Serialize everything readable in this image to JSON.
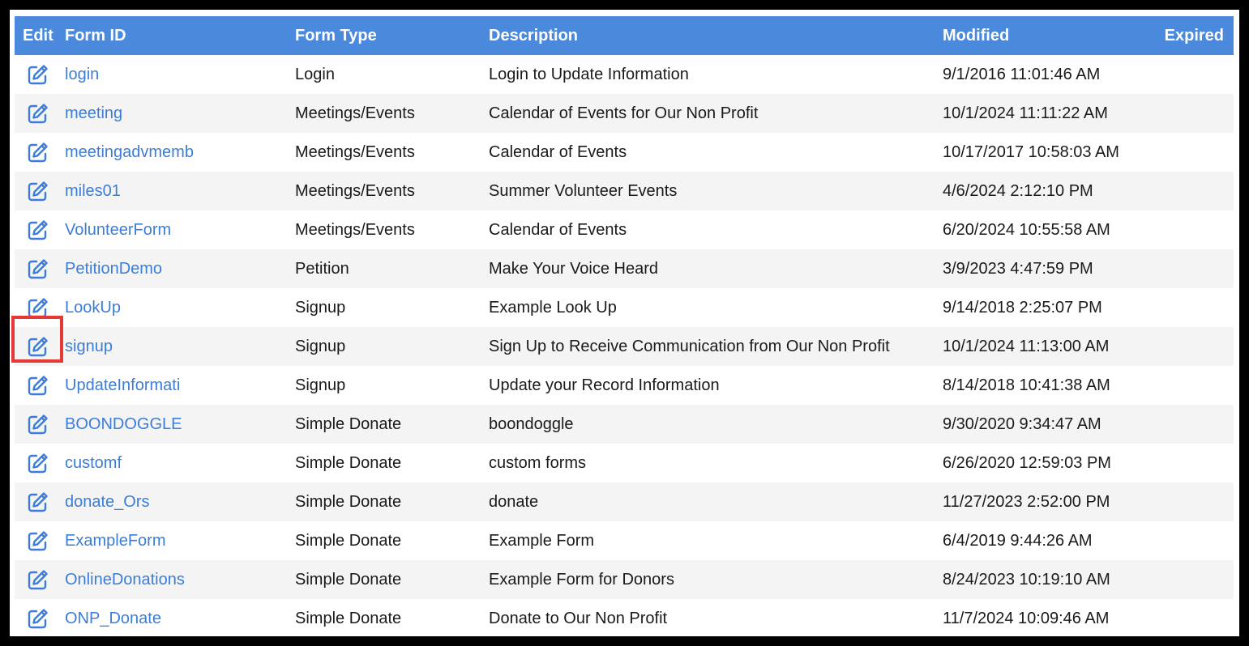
{
  "colors": {
    "header_bg": "#4a89dc",
    "link": "#3b7dd8",
    "highlight": "#e53935"
  },
  "table": {
    "headers": {
      "edit": "Edit",
      "form_id": "Form ID",
      "form_type": "Form Type",
      "description": "Description",
      "modified": "Modified",
      "expired": "Expired"
    },
    "rows": [
      {
        "form_id": "login",
        "form_type": "Login",
        "description": "Login to Update Information",
        "modified": "9/1/2016 11:01:46 AM",
        "expired": ""
      },
      {
        "form_id": "meeting",
        "form_type": "Meetings/Events",
        "description": "Calendar of Events for Our Non Profit",
        "modified": "10/1/2024 11:11:22 AM",
        "expired": ""
      },
      {
        "form_id": "meetingadvmemb",
        "form_type": "Meetings/Events",
        "description": "Calendar of Events",
        "modified": "10/17/2017 10:58:03 AM",
        "expired": ""
      },
      {
        "form_id": "miles01",
        "form_type": "Meetings/Events",
        "description": "Summer Volunteer Events",
        "modified": "4/6/2024 2:12:10 PM",
        "expired": ""
      },
      {
        "form_id": "VolunteerForm",
        "form_type": "Meetings/Events",
        "description": "Calendar of Events",
        "modified": "6/20/2024 10:55:58 AM",
        "expired": ""
      },
      {
        "form_id": "PetitionDemo",
        "form_type": "Petition",
        "description": "Make Your Voice Heard",
        "modified": "3/9/2023 4:47:59 PM",
        "expired": ""
      },
      {
        "form_id": "LookUp",
        "form_type": "Signup",
        "description": "Example Look Up",
        "modified": "9/14/2018 2:25:07 PM",
        "expired": ""
      },
      {
        "form_id": "signup",
        "form_type": "Signup",
        "description": "Sign Up to Receive Communication from Our Non Profit",
        "modified": "10/1/2024 11:13:00 AM",
        "expired": ""
      },
      {
        "form_id": "UpdateInformati",
        "form_type": "Signup",
        "description": "Update your Record Information",
        "modified": "8/14/2018 10:41:38 AM",
        "expired": ""
      },
      {
        "form_id": "BOONDOGGLE",
        "form_type": "Simple Donate",
        "description": "boondoggle",
        "modified": "9/30/2020 9:34:47 AM",
        "expired": ""
      },
      {
        "form_id": "customf",
        "form_type": "Simple Donate",
        "description": "custom forms",
        "modified": "6/26/2020 12:59:03 PM",
        "expired": ""
      },
      {
        "form_id": "donate_Ors",
        "form_type": "Simple Donate",
        "description": "donate",
        "modified": "11/27/2023 2:52:00 PM",
        "expired": ""
      },
      {
        "form_id": "ExampleForm",
        "form_type": "Simple Donate",
        "description": "Example Form",
        "modified": "6/4/2019 9:44:26 AM",
        "expired": ""
      },
      {
        "form_id": "OnlineDonations",
        "form_type": "Simple Donate",
        "description": "Example Form for Donors",
        "modified": "8/24/2023 10:19:10 AM",
        "expired": ""
      },
      {
        "form_id": "ONP_Donate",
        "form_type": "Simple Donate",
        "description": "Donate to Our Non Profit",
        "modified": "11/7/2024 10:09:46 AM",
        "expired": ""
      }
    ],
    "highlighted_row": "signup",
    "edit_icon": "edit-pencil-square-icon"
  }
}
